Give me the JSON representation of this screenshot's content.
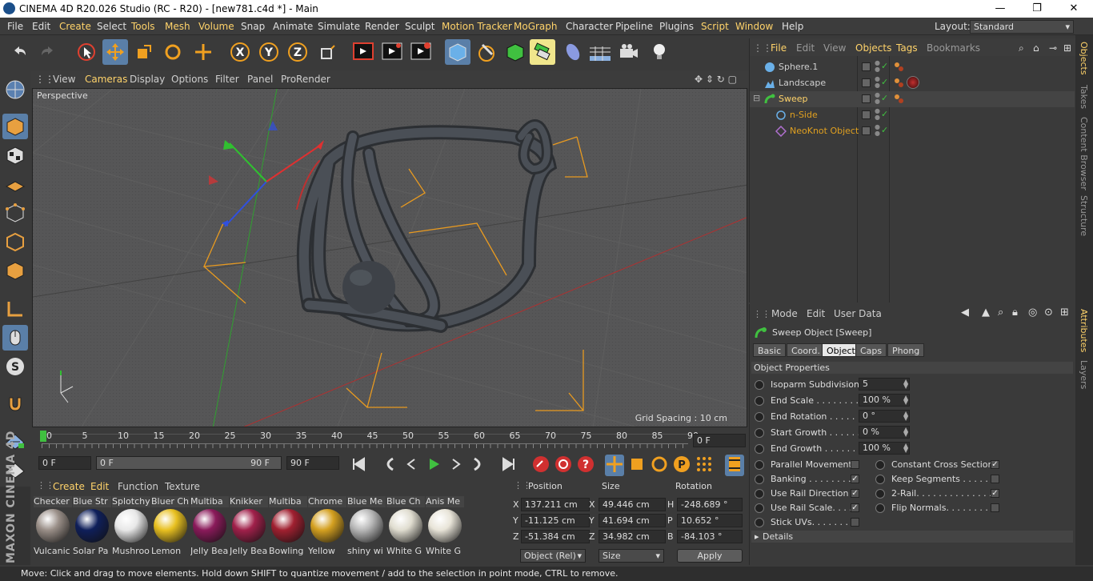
{
  "window": {
    "title": "CINEMA 4D R20.026 Studio (RC - R20) - [new781.c4d *] - Main",
    "minimize": "—",
    "maximize": "❐",
    "close": "✕"
  },
  "menu": {
    "items": [
      "File",
      "Edit",
      "Create",
      "Select",
      "Tools",
      "Mesh",
      "Volume",
      "Snap",
      "Animate",
      "Simulate",
      "Render",
      "Sculpt",
      "Motion Tracker",
      "MoGraph",
      "Character",
      "Pipeline",
      "Plugins",
      "Script",
      "Window",
      "Help"
    ],
    "layout_label": "Layout:",
    "layout_value": "Standard"
  },
  "viewport": {
    "menu": [
      "View",
      "Cameras",
      "Display",
      "Options",
      "Filter",
      "Panel",
      "ProRender"
    ],
    "label": "Perspective",
    "grid_spacing": "Grid Spacing : 10 cm"
  },
  "timeline": {
    "ticks": [
      "0",
      "5",
      "10",
      "15",
      "20",
      "25",
      "30",
      "35",
      "40",
      "45",
      "50",
      "55",
      "60",
      "65",
      "70",
      "75",
      "80",
      "85",
      "90"
    ],
    "current_frame": "0 F",
    "start": "0 F",
    "range_start": "0 F",
    "range_end": "90 F",
    "end": "90 F"
  },
  "materials": {
    "menu": [
      "Create",
      "Edit",
      "Function",
      "Texture"
    ],
    "items": [
      {
        "name": "Checker",
        "label": "Vulcanic",
        "color": "#9a8f88"
      },
      {
        "name": "Blue Str",
        "label": "Solar Pa",
        "color": "#0f1f5a"
      },
      {
        "name": "Splotchy",
        "label": "Mushroo",
        "color": "#e8e8e8"
      },
      {
        "name": "Bluer Ch",
        "label": "Lemon",
        "color": "#e8c020"
      },
      {
        "name": "Multiba",
        "label": "Jelly Bea",
        "color": "#8a1a5a"
      },
      {
        "name": "Knikker",
        "label": "Jelly Bea",
        "color": "#a0204a"
      },
      {
        "name": "Multiba",
        "label": "Bowling",
        "color": "#a02030"
      },
      {
        "name": "Chrome",
        "label": "Yellow",
        "color": "#d4a020"
      },
      {
        "name": "Blue Me",
        "label": "shiny wi",
        "color": "#b8b8b8"
      },
      {
        "name": "Blue Ch",
        "label": "White G",
        "color": "#e0ddd0"
      },
      {
        "name": "Anis Me",
        "label": "White G",
        "color": "#e8e4d8"
      }
    ]
  },
  "coordinates": {
    "headers": [
      "Position",
      "Size",
      "Rotation"
    ],
    "rows": [
      {
        "axis": "X",
        "pos": "137.211 cm",
        "saxis": "X",
        "size": "49.446 cm",
        "raxis": "H",
        "rot": "-248.689 °"
      },
      {
        "axis": "Y",
        "pos": "-11.125 cm",
        "saxis": "Y",
        "size": "41.694 cm",
        "raxis": "P",
        "rot": "10.652 °"
      },
      {
        "axis": "Z",
        "pos": "-51.384 cm",
        "saxis": "Z",
        "size": "34.982 cm",
        "raxis": "B",
        "rot": "-84.103 °"
      }
    ],
    "mode": "Object (Rel)",
    "size_mode": "Size",
    "apply": "Apply"
  },
  "objects": {
    "menu": [
      "File",
      "Edit",
      "View",
      "Objects",
      "Tags",
      "Bookmarks"
    ],
    "tree": [
      {
        "name": "Sphere.1",
        "color": "#cfcfcf",
        "indent": 0
      },
      {
        "name": "Landscape",
        "color": "#cfcfcf",
        "indent": 0
      },
      {
        "name": "Sweep",
        "color": "#ffd36a",
        "indent": 0
      },
      {
        "name": "n-Side",
        "color": "#e0a020",
        "indent": 1
      },
      {
        "name": "NeoKnot Object",
        "color": "#e0a020",
        "indent": 1
      }
    ]
  },
  "attributes": {
    "menu": [
      "Mode",
      "Edit",
      "User Data"
    ],
    "object_title": "Sweep Object [Sweep]",
    "tabs": [
      "Basic",
      "Coord.",
      "Object",
      "Caps",
      "Phong"
    ],
    "selected_tab": "Object",
    "section": "Object Properties",
    "fields": [
      {
        "label": "Isoparm Subdivision",
        "value": "5"
      },
      {
        "label": "End Scale . . . . . . . . .",
        "value": "100 %"
      },
      {
        "label": "End Rotation . . . . . .",
        "value": "0 °"
      },
      {
        "label": "Start Growth . . . . . .",
        "value": "0 %"
      },
      {
        "label": "End Growth . . . . . . .",
        "value": "100 %"
      }
    ],
    "checks_left": [
      {
        "label": "Parallel Movement",
        "checked": ""
      },
      {
        "label": "Banking . . . . . . . . .",
        "checked": "✓"
      },
      {
        "label": "Use Rail Direction",
        "checked": "✓"
      },
      {
        "label": "Use Rail Scale. . . . .",
        "checked": "✓"
      },
      {
        "label": "Stick UVs. . . . . . . .",
        "checked": ""
      }
    ],
    "checks_right": [
      {
        "label": "Constant Cross Section",
        "checked": "✓"
      },
      {
        "label": "Keep Segments . . . . . .",
        "checked": ""
      },
      {
        "label": "2-Rail. . . . . . . . . . . . . .",
        "checked": "✓"
      },
      {
        "label": "Flip Normals. . . . . . . . .",
        "checked": ""
      }
    ],
    "details": "Details"
  },
  "side_tabs": [
    "Objects",
    "Takes",
    "Content Browser",
    "Structure",
    "Attributes",
    "Layers"
  ],
  "brand": "MAXON CINEMA 4D",
  "status": "Move: Click and drag to move elements. Hold down SHIFT to quantize movement / add to the selection in point mode, CTRL to remove."
}
